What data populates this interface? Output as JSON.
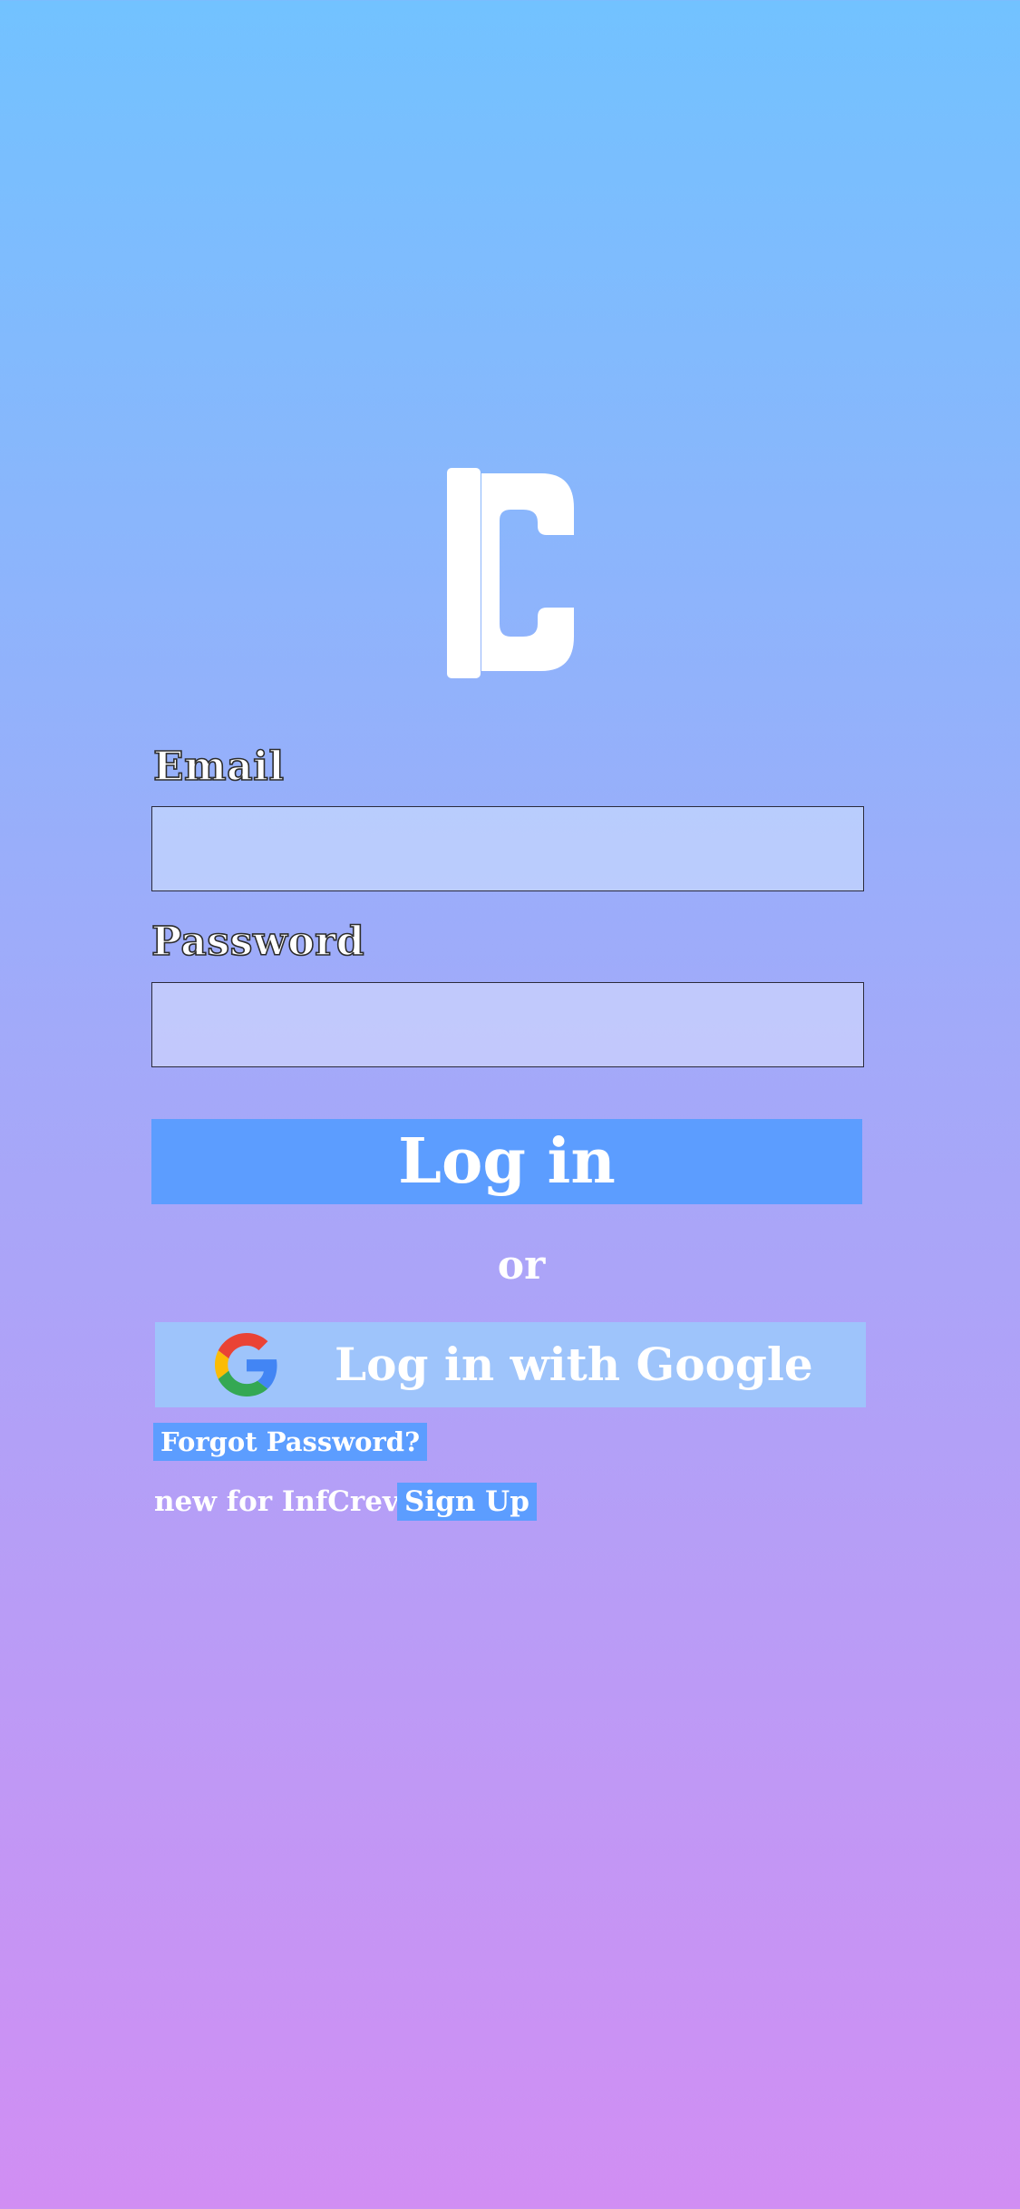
{
  "logo": {
    "icon": "app-logo-c-icon"
  },
  "form": {
    "email_label": "Email",
    "email_value": "",
    "email_placeholder": "",
    "password_label": "Password",
    "password_value": "",
    "password_placeholder": "",
    "login_label": "Log in",
    "or_text": "or",
    "google_label": "Log in with Google",
    "google_icon": "google-g-icon",
    "forgot_label": "Forgot Password?",
    "new_text": "new for InfCrev ?",
    "signup_label": "Sign Up"
  },
  "colors": {
    "background_top": "#72c2ff",
    "background_bottom": "#d18ef3",
    "primary_button": "#5c9dff",
    "google_button": "#9ec4fb"
  }
}
